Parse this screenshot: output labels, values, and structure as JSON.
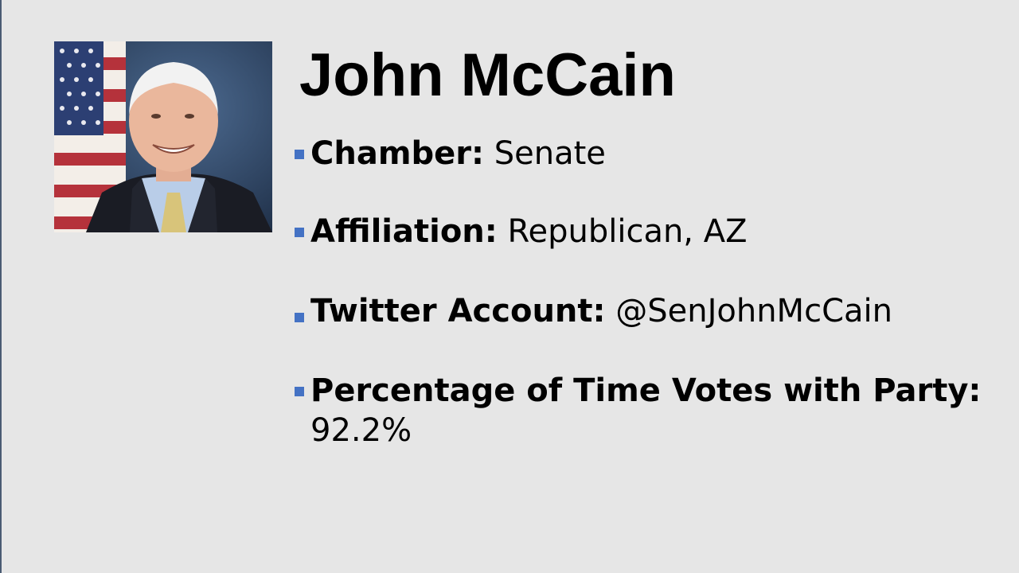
{
  "slide": {
    "title": "John McCain",
    "accent_color": "#4472c4",
    "background_color": "#e6e6e6",
    "photo": "portrait-of-john-mccain-with-us-flag",
    "bullets": [
      {
        "label": "Chamber:",
        "value": "Senate"
      },
      {
        "label": "Affiliation:",
        "value": "Republican, AZ"
      },
      {
        "label": "Twitter Account:",
        "value": "@SenJohnMcCain"
      },
      {
        "label": "Percentage of Time Votes with Party:",
        "value": "92.2%"
      }
    ]
  }
}
